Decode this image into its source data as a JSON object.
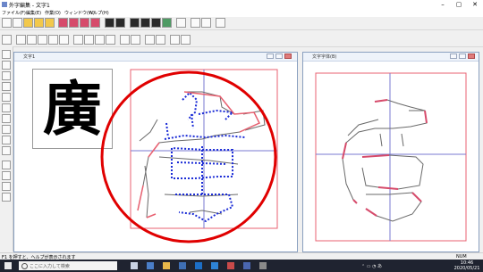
{
  "window": {
    "title": "外字編集 - 文字1",
    "minimize": "–",
    "maximize": "▢",
    "close": "✕"
  },
  "menu": [
    "ファイル(F)",
    "編集(E)",
    "作業(O)",
    "ウィンドウ(W)",
    "ヘルプ(H)"
  ],
  "toolbar1": [
    "new",
    "open",
    "open2",
    "open3",
    "prop",
    "prop2",
    "save",
    "save2",
    "view1",
    "view2",
    "view3",
    "view4",
    "globe",
    "zoom-in",
    "zoom-out",
    "help"
  ],
  "toolbar2": [
    "select",
    "rect",
    "line",
    "circle",
    "ellipse",
    "curve",
    "pen1",
    "pen2",
    "pen3",
    "pen4",
    "flip-h",
    "flip-v",
    "move",
    "rotate",
    "mirror1",
    "mirror2"
  ],
  "lefttools": [
    "t1",
    "t2",
    "t3",
    "t4",
    "t5",
    "t6",
    "t7",
    "t8",
    "t9",
    "t10",
    "t11",
    "t12",
    "t13",
    "t14"
  ],
  "editor": {
    "title": "文字1",
    "preview_char": "廣"
  },
  "preview_window": {
    "title": "文字字体(B)"
  },
  "status": {
    "left": "F1 を押すと、ヘルプが表示されます",
    "right": "NUM"
  },
  "taskbar": {
    "search": "ここに入力して検索",
    "time": "10:46",
    "date": "2020/05/21"
  },
  "colors": {
    "accent": "#e00000",
    "outline": "#6a6a6a",
    "points": "#1a2bd6"
  }
}
